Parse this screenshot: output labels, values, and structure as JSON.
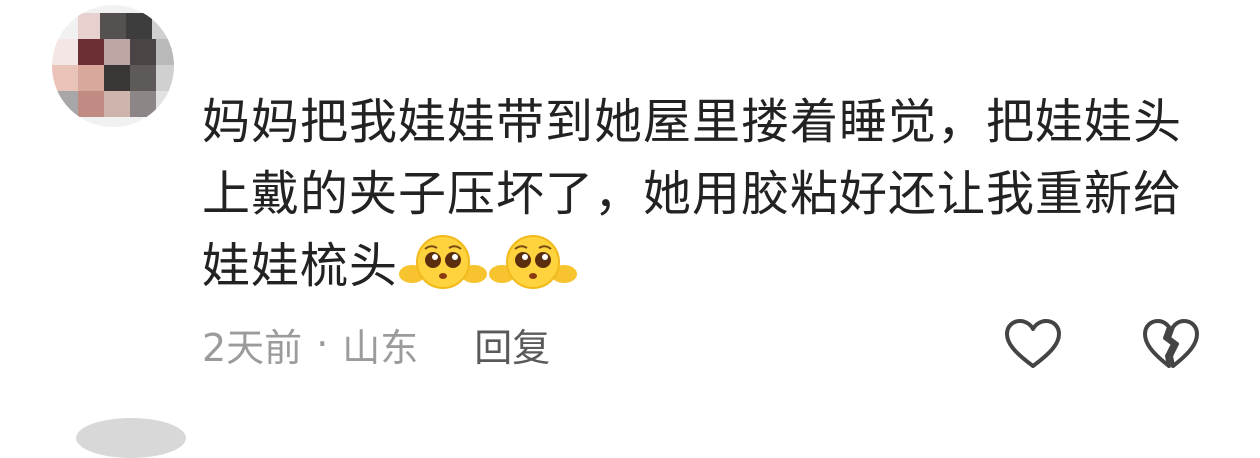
{
  "comment": {
    "text": "妈妈把我娃娃带到她屋里搂着睡觉，把娃娃头上戴的夹子压坏了，她用胶粘好还让我重新给娃娃梳头",
    "emojis": [
      "pleading-face-emoji",
      "pleading-face-emoji"
    ]
  },
  "meta": {
    "time": "2天前",
    "separator": "·",
    "location": "山东",
    "reply_label": "回复"
  },
  "icons": {
    "like": "heart-outline-icon",
    "dislike": "broken-heart-icon"
  },
  "colors": {
    "text": "#222222",
    "meta": "#9b9b9b",
    "reply": "#5a5a5a",
    "icon": "#444444",
    "emoji": "#ffcc33"
  }
}
